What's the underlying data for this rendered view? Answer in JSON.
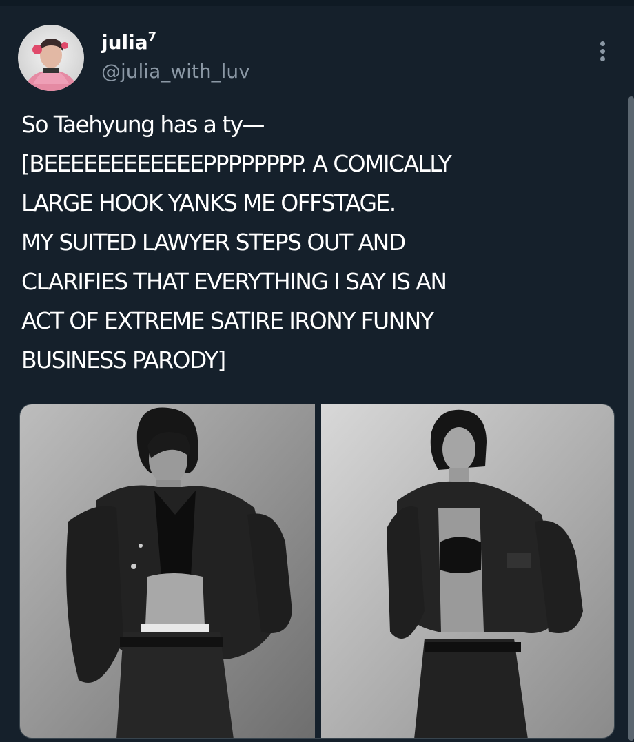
{
  "tweet": {
    "author": {
      "display_name": "julia",
      "name_superscript": "7",
      "handle": "@julia_with_luv"
    },
    "text_lines": [
      "So Taehyung has a ty—",
      "[BEEEEEEEEEEEEPPPPPPPP. A COMICALLY",
      "LARGE HOOK YANKS ME OFFSTAGE.",
      "MY SUITED LAWYER STEPS OUT AND",
      "CLARIFIES THAT EVERYTHING I SAY IS AN",
      "ACT OF EXTREME SATIRE IRONY FUNNY",
      "BUSINESS PARODY]"
    ],
    "media": [
      {
        "icon": "photo-man-denim-jacket",
        "tone": "grayscale"
      },
      {
        "icon": "photo-woman-denim-jacket",
        "tone": "grayscale"
      }
    ],
    "more_icon": "more-vertical-icon"
  },
  "theme": {
    "background": "#15202b",
    "text_primary": "#ffffff",
    "text_secondary": "#8b98a5",
    "border": "#38444d"
  }
}
